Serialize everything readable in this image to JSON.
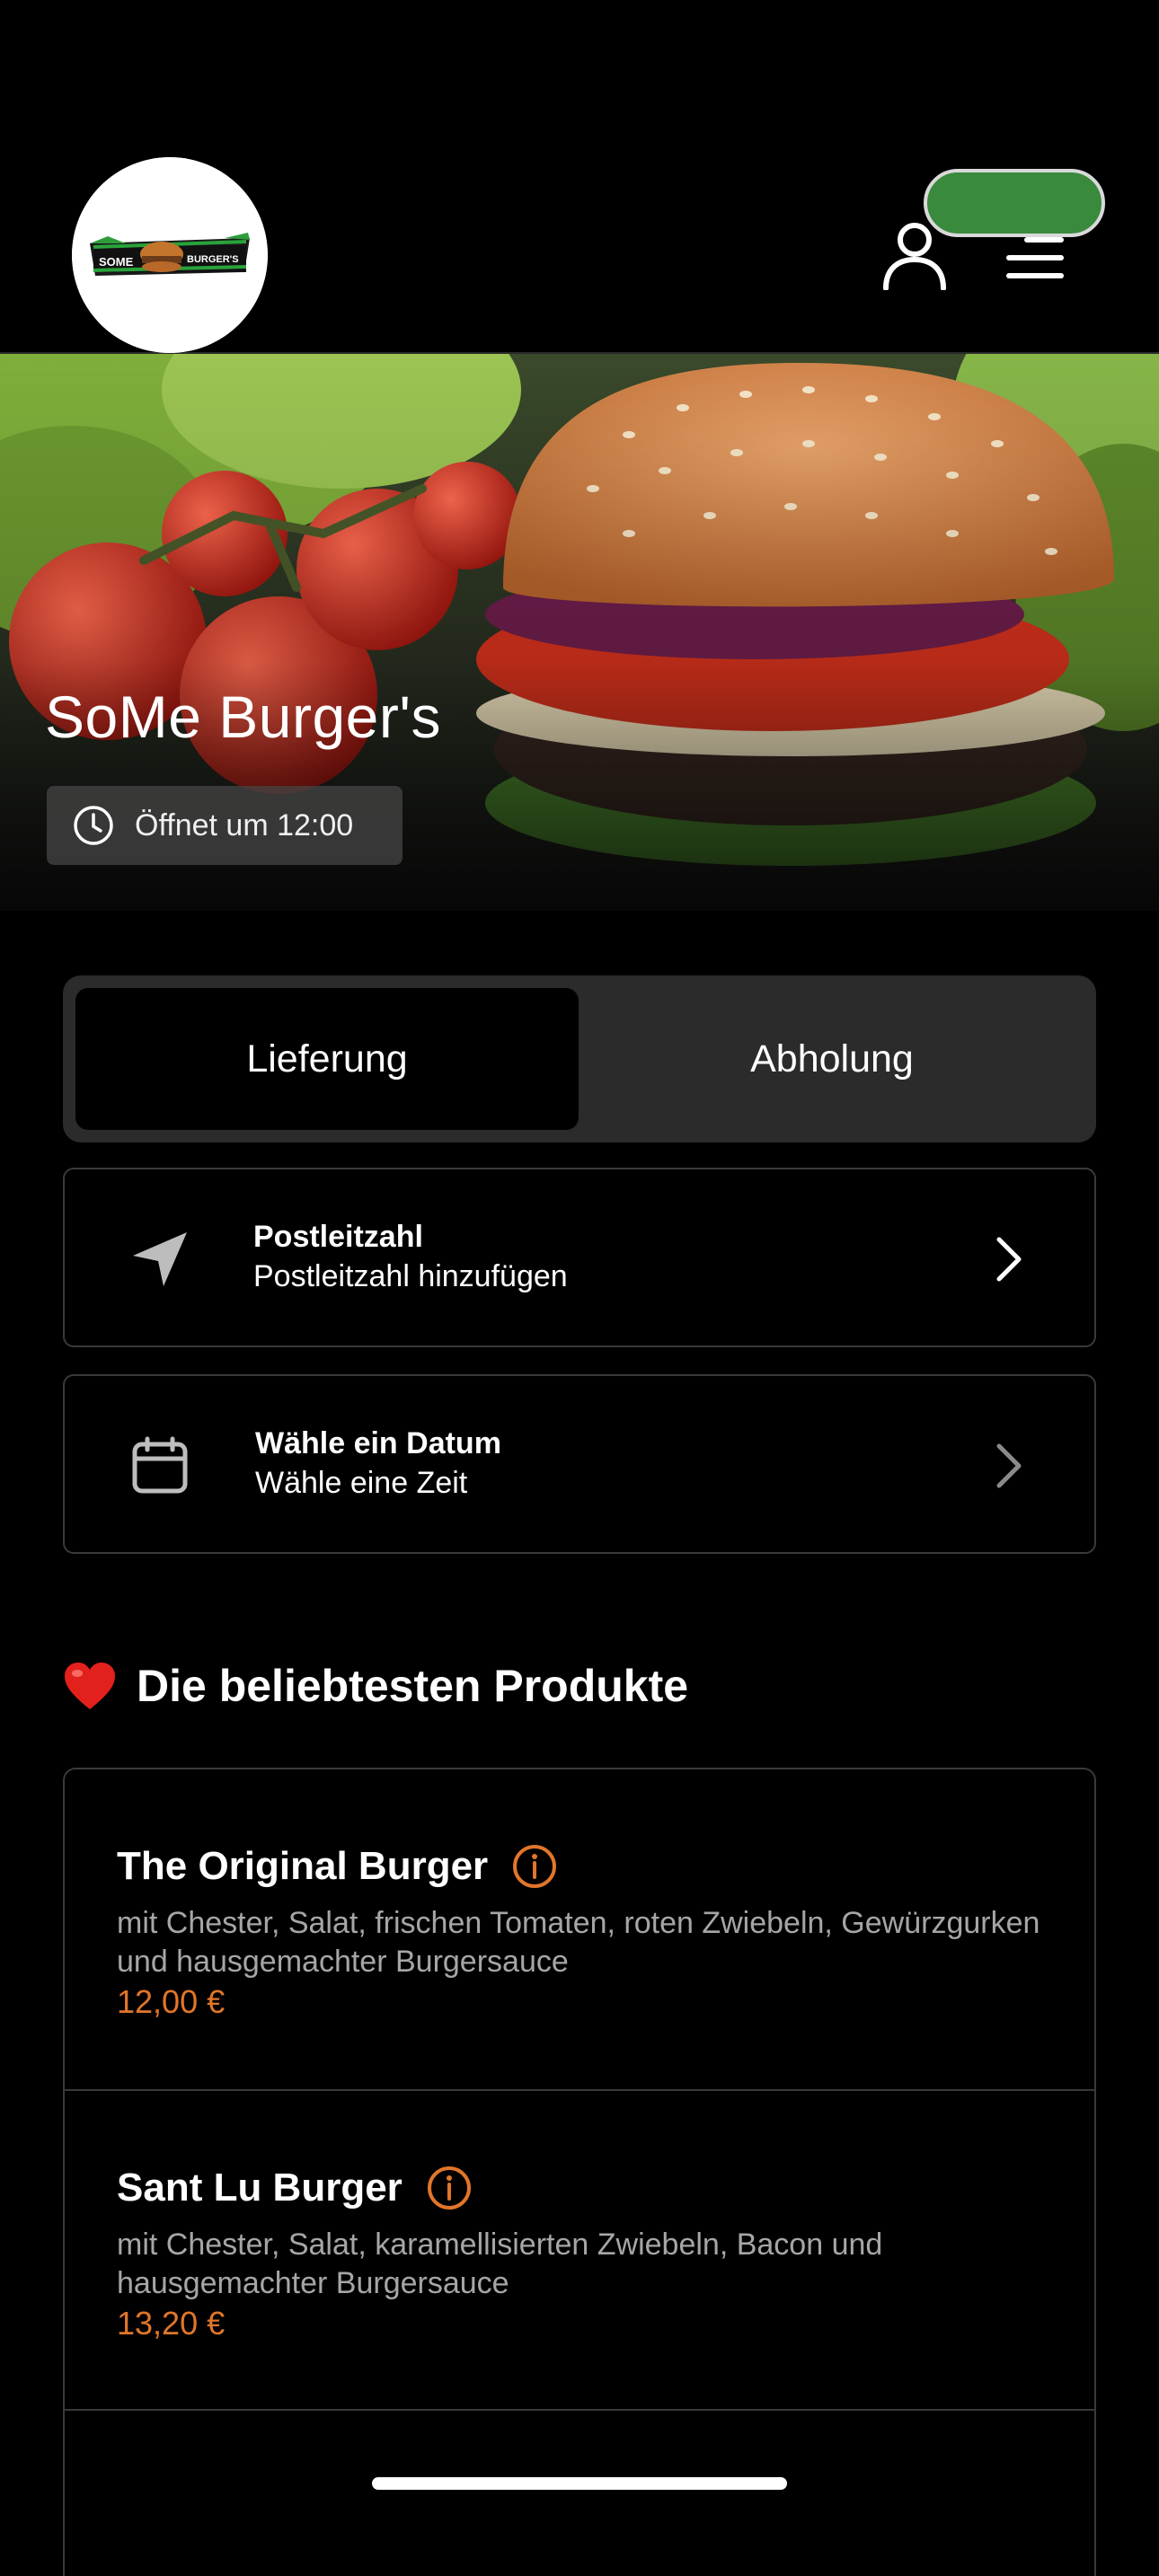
{
  "header": {
    "logo_text_left": "SOME",
    "logo_text_right": "BURGER'S",
    "profile_icon": "user-icon",
    "menu_icon": "hamburger-menu-icon",
    "status_pill_color": "#3a8a3e"
  },
  "hero": {
    "title": "SoMe Burger's",
    "open_status": "Öffnet um 12:00",
    "open_icon": "clock-icon"
  },
  "order_mode": {
    "options": [
      "Lieferung",
      "Abholung"
    ],
    "selected": "Lieferung"
  },
  "postcode": {
    "label": "Postleitzahl",
    "value": "Postleitzahl hinzufügen",
    "icon": "location-arrow-icon"
  },
  "datetime": {
    "label": "Wähle ein Datum",
    "value": "Wähle eine Zeit",
    "icon": "calendar-icon"
  },
  "popular": {
    "title": "Die beliebtesten Produkte",
    "icon": "heart-icon",
    "accent_color": "#e0762a",
    "products": [
      {
        "name": "The Original Burger",
        "description": "mit Chester, Salat, frischen Tomaten, roten Zwiebeln, Gewürzgurken und hausgemachter Burgersauce",
        "price": "12,00 €"
      },
      {
        "name": "Sant Lu Burger",
        "description": "mit Chester, Salat, karamellisierten Zwiebeln, Bacon und hausgemachter Burgersauce",
        "price": "13,20 €"
      }
    ]
  }
}
